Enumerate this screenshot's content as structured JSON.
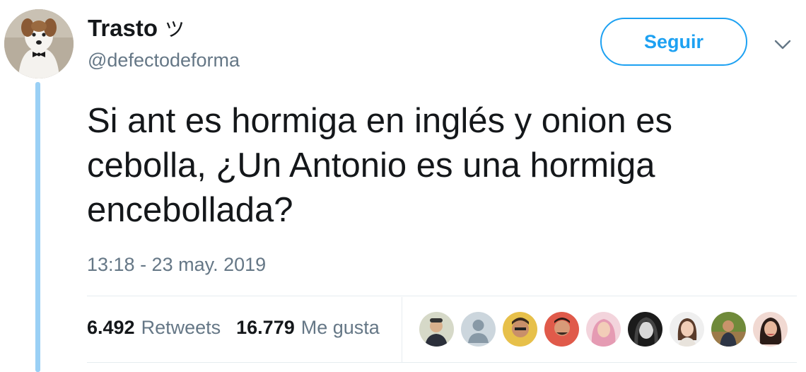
{
  "author": {
    "display_name": "Trasto",
    "name_emoji": "ツ",
    "handle": "@defectodeforma",
    "avatar_icon": "dog-avatar-icon"
  },
  "follow_button": {
    "label": "Seguir"
  },
  "menu": {
    "icon": "chevron-down-icon"
  },
  "tweet": {
    "text": "Si ant es hormiga en inglés y onion es\ncebolla, ¿Un Antonio es una hormiga\nencebollada?",
    "timestamp": "13:18 - 23 may. 2019"
  },
  "stats": {
    "retweets_count": "6.492",
    "retweets_label": "Retweets",
    "likes_count": "16.779",
    "likes_label": "Me gusta"
  },
  "colors": {
    "accent": "#1da1f2",
    "thread_line": "#9ad0f5",
    "secondary_text": "#657786",
    "divider": "#e6ecf0"
  }
}
